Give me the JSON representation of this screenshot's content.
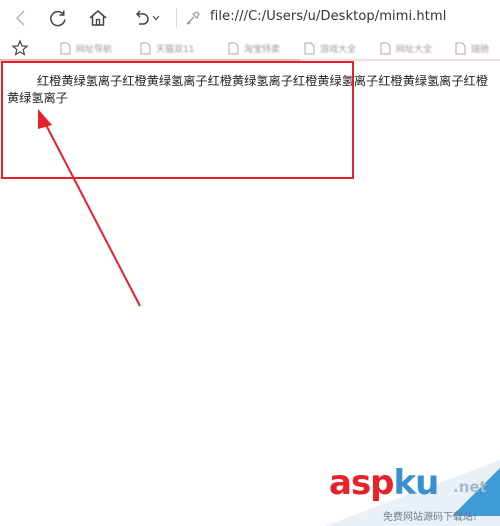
{
  "toolbar": {
    "url": "file:///C:/Users/u/Desktop/mimi.html"
  },
  "favorites": [
    {
      "label": "网址导航"
    },
    {
      "label": "天猫双11"
    },
    {
      "label": "淘宝特卖"
    },
    {
      "label": "游戏大全"
    },
    {
      "label": "网址大全"
    },
    {
      "label": "瑞驰"
    }
  ],
  "page": {
    "text": "红橙黄绿氢离子红橙黄绿氢离子红橙黄绿氢离子红橙黄绿氢离子红橙黄绿氢离子红橙黄绿氢离子"
  },
  "watermark": {
    "logo_asp": "asp",
    "logo_ku": "ku",
    "logo_net": ".net",
    "subtitle": "免费网站源码下载站!"
  },
  "colors": {
    "annotation_red": "#e8202a",
    "link_blue": "#3a8fd0"
  }
}
